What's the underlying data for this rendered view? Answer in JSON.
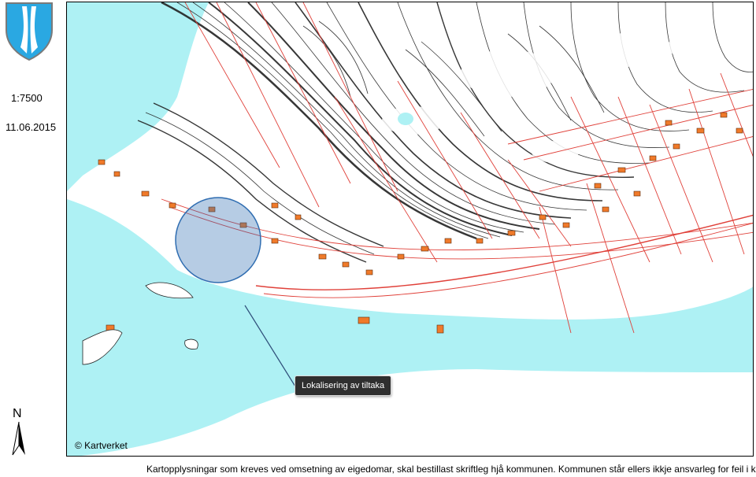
{
  "sidebar": {
    "crest_icon": "municipal-coat-of-arms-icon",
    "scale": "1:7500",
    "date": "11.06.2015",
    "north_label": "N",
    "north_icon": "north-arrow-icon"
  },
  "map": {
    "copyright": "© Kartverket",
    "callout_label": "Lokalisering av tiltaka",
    "colors": {
      "water": "#aef1f4",
      "contour": "#222222",
      "property_lines": "#e0413a",
      "buildings": "#f07a2a",
      "marker": "#2f6db1"
    }
  },
  "footer": {
    "disclaimer": "Kartopplysningar som kreves ved omsetning av eigedomar, skal bestillast skriftleg hjå kommunen. Kommunen står ellers ikkje ansvarleg for feil i kartet."
  }
}
